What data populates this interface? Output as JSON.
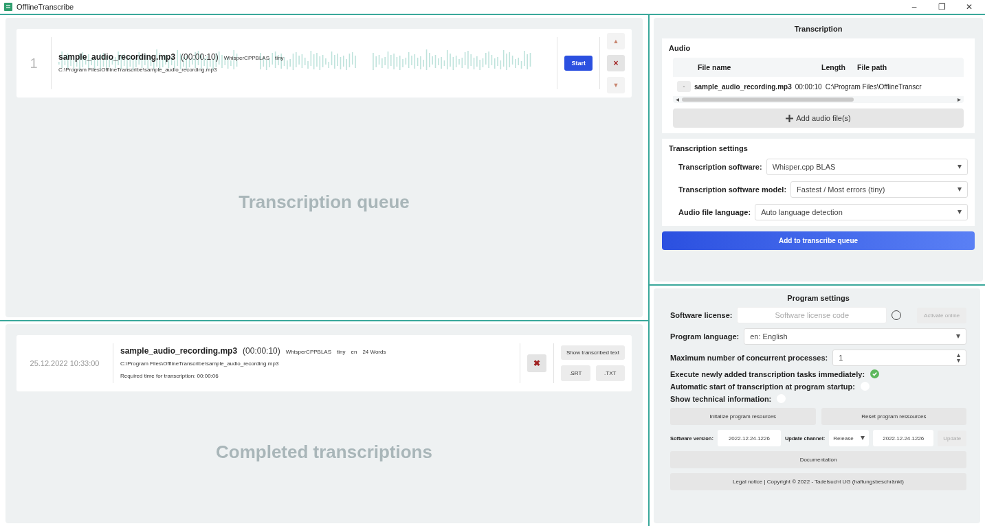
{
  "window": {
    "title": "OfflineTranscribe",
    "controls": [
      "–",
      "❐",
      "✕"
    ]
  },
  "queue": {
    "watermark": "Transcription queue",
    "items": [
      {
        "index": "1",
        "file": "sample_audio_recording.mp3",
        "duration": "(00:00:10)",
        "software": "WhisperCPPBLAS",
        "model": "tiny",
        "path": "C:\\Program Files\\OfflineTranscribe\\sample_audio_recording.mp3",
        "start_label": "Start",
        "move_up": "▲",
        "remove": "×",
        "move_down": "▼"
      }
    ]
  },
  "completed": {
    "watermark": "Completed transcriptions",
    "items": [
      {
        "date": "25.12.2022 10:33:00",
        "file": "sample_audio_recording.mp3",
        "duration": "(00:00:10)",
        "software": "WhisperCPPBLAS",
        "model": "tiny",
        "language": "en",
        "words": "24 Words",
        "path": "C:\\Program Files\\OfflineTranscribe\\sample_audio_recording.mp3",
        "required_time": "Required time for transcription:  00:00:06",
        "remove": "✖",
        "show_text": "Show transcribed text",
        "srt": ".SRT",
        "txt": ".TXT"
      }
    ]
  },
  "transcription": {
    "title": "Transcription",
    "audio_title": "Audio",
    "table": {
      "columns": [
        "File name",
        "Length",
        "File path"
      ],
      "rows": [
        {
          "remove": "-",
          "file": "sample_audio_recording.mp3",
          "length": "00:00:10",
          "path": "C:\\Program Files\\OfflineTranscr"
        }
      ]
    },
    "add_files": "Add audio file(s)",
    "settings_title": "Transcription settings",
    "settings": [
      {
        "label": "Transcription software:",
        "value": "Whisper.cpp BLAS"
      },
      {
        "label": "Transcription software model:",
        "value": "Fastest / Most errors (tiny)"
      },
      {
        "label": "Audio file language:",
        "value": "Auto language detection"
      }
    ],
    "submit": "Add to transcribe queue"
  },
  "program_settings": {
    "title": "Program settings",
    "license_label": "Software license:",
    "license_placeholder": "Software license code",
    "license_active": false,
    "activate": "Activate online",
    "language_label": "Program language:",
    "language": "en: English",
    "processes_label": "Maximum number of concurrent processes:",
    "processes": "1",
    "toggles": [
      {
        "label": "Execute newly added transcription tasks immediately:",
        "checked": true
      },
      {
        "label": "Automatic start of transcription at program startup:",
        "checked": false
      },
      {
        "label": "Show technical information:",
        "checked": false
      }
    ],
    "init": "Initalize program resources",
    "reset": "Reset program ressources",
    "version_label": "Software version:",
    "version": "2022.12.24.1226",
    "channel_label": "Update channel:",
    "channel": "Release",
    "latest": "2022.12.24.1226",
    "update": "Update",
    "docs": "Documentation",
    "legal": "Legal notice | Copyright © 2022 - Tadelsucht UG (haftungsbeschränkt)"
  }
}
